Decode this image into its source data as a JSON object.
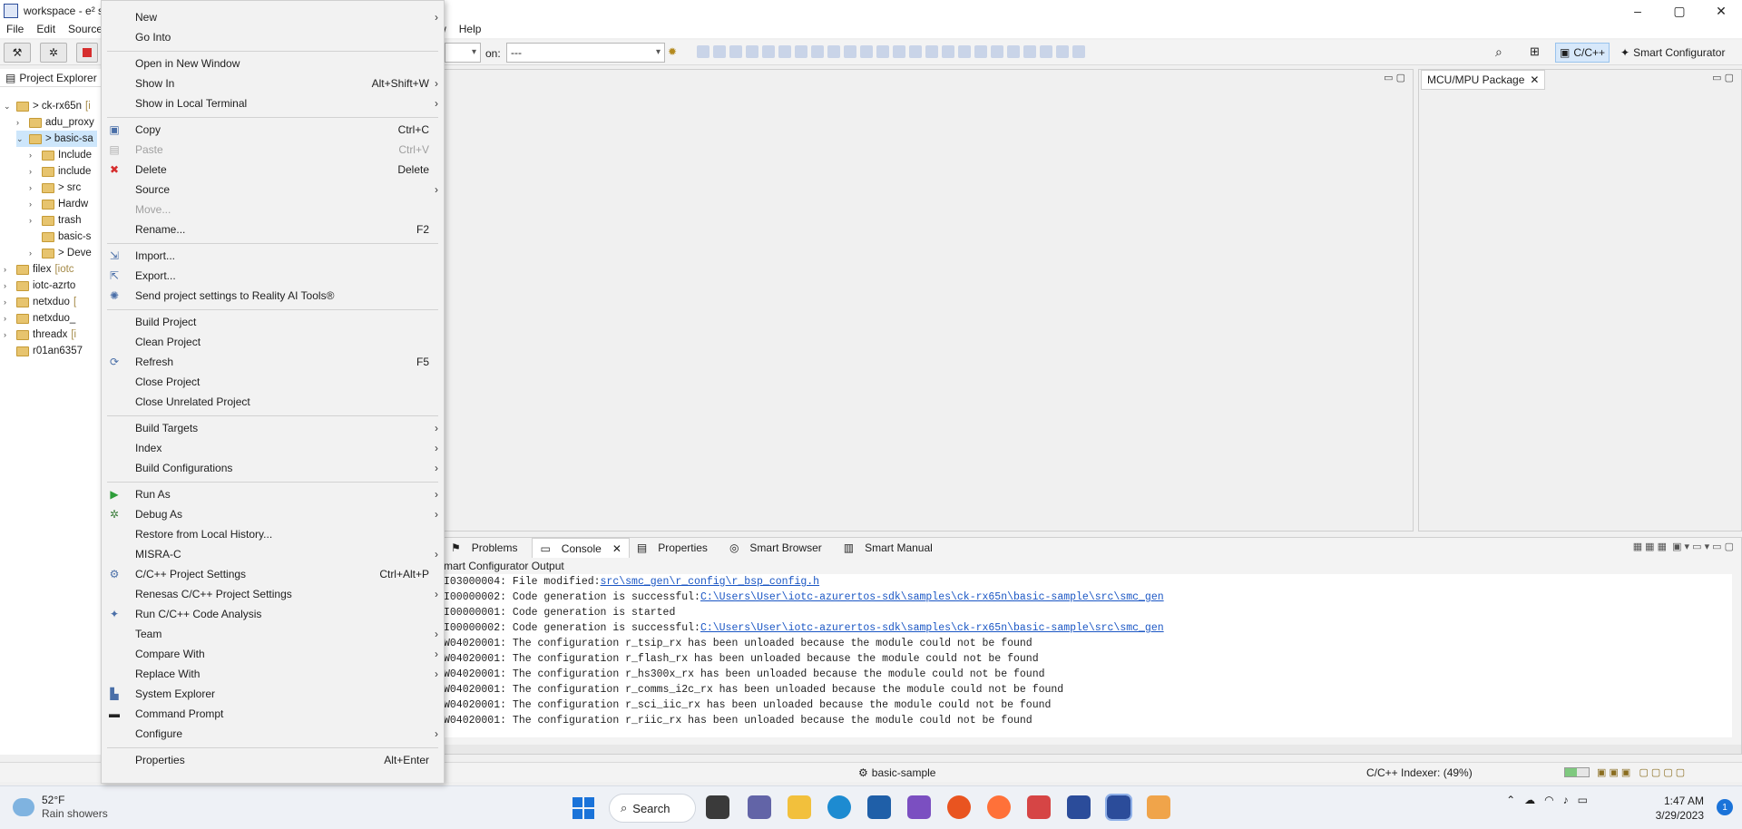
{
  "window": {
    "title": "workspace - e² s",
    "controls": [
      "–",
      "▢",
      "✕"
    ]
  },
  "menubar": [
    "File",
    "Edit",
    "Source",
    "ndow",
    "Help"
  ],
  "toolbar": {
    "combo_value": "---",
    "combo_label": "on:",
    "perspective_active": "C/C++",
    "perspective_other": "Smart Configurator"
  },
  "explorer": {
    "tab_label": "Project Explorer",
    "items": [
      {
        "label": "> ck-rx65n",
        "deco": "[i",
        "depth": 0
      },
      {
        "label": "adu_proxy",
        "deco": "",
        "depth": 1
      },
      {
        "label": "> basic-sa",
        "deco": "",
        "depth": 1
      },
      {
        "label": "Include",
        "deco": "",
        "depth": 2
      },
      {
        "label": "include",
        "deco": "",
        "depth": 2
      },
      {
        "label": "> src",
        "deco": "",
        "depth": 2
      },
      {
        "label": "Hardw",
        "deco": "",
        "depth": 2
      },
      {
        "label": "trash",
        "deco": "",
        "depth": 2
      },
      {
        "label": "basic-s",
        "deco": "",
        "depth": 2
      },
      {
        "label": "> Deve",
        "deco": "",
        "depth": 2
      },
      {
        "label": "filex",
        "deco": "[iotc",
        "depth": 0
      },
      {
        "label": "iotc-azrto",
        "deco": "",
        "depth": 0
      },
      {
        "label": "netxduo",
        "deco": "[",
        "depth": 0
      },
      {
        "label": "netxduo_",
        "deco": "",
        "depth": 0
      },
      {
        "label": "threadx",
        "deco": "[i",
        "depth": 0
      },
      {
        "label": "r01an6357",
        "deco": "",
        "depth": 0
      }
    ]
  },
  "context_menu": {
    "items": [
      {
        "label": "New",
        "shortcut": "",
        "submenu": true,
        "icon": "",
        "disabled": false
      },
      {
        "label": "Go Into",
        "shortcut": "",
        "submenu": false,
        "icon": "",
        "disabled": false
      },
      {
        "sep": true
      },
      {
        "label": "Open in New Window",
        "shortcut": "",
        "submenu": false,
        "icon": "",
        "disabled": false
      },
      {
        "label": "Show In",
        "shortcut": "Alt+Shift+W",
        "submenu": true,
        "icon": "",
        "disabled": false
      },
      {
        "label": "Show in Local Terminal",
        "shortcut": "",
        "submenu": true,
        "icon": "",
        "disabled": false
      },
      {
        "sep": true
      },
      {
        "label": "Copy",
        "shortcut": "Ctrl+C",
        "submenu": false,
        "icon": "copy-icon",
        "disabled": false
      },
      {
        "label": "Paste",
        "shortcut": "Ctrl+V",
        "submenu": false,
        "icon": "paste-icon",
        "disabled": true
      },
      {
        "label": "Delete",
        "shortcut": "Delete",
        "submenu": false,
        "icon": "delete-icon",
        "disabled": false
      },
      {
        "label": "Source",
        "shortcut": "",
        "submenu": true,
        "icon": "",
        "disabled": false
      },
      {
        "label": "Move...",
        "shortcut": "",
        "submenu": false,
        "icon": "",
        "disabled": true
      },
      {
        "label": "Rename...",
        "shortcut": "F2",
        "submenu": false,
        "icon": "",
        "disabled": false
      },
      {
        "sep": true
      },
      {
        "label": "Import...",
        "shortcut": "",
        "submenu": false,
        "icon": "import-icon",
        "disabled": false
      },
      {
        "label": "Export...",
        "shortcut": "",
        "submenu": false,
        "icon": "export-icon",
        "disabled": false
      },
      {
        "label": "Send project settings to Reality AI Tools®",
        "shortcut": "",
        "submenu": false,
        "icon": "reality-ai-icon",
        "disabled": false
      },
      {
        "sep": true
      },
      {
        "label": "Build Project",
        "shortcut": "",
        "submenu": false,
        "icon": "",
        "disabled": false
      },
      {
        "label": "Clean Project",
        "shortcut": "",
        "submenu": false,
        "icon": "",
        "disabled": false
      },
      {
        "label": "Refresh",
        "shortcut": "F5",
        "submenu": false,
        "icon": "refresh-icon",
        "disabled": false
      },
      {
        "label": "Close Project",
        "shortcut": "",
        "submenu": false,
        "icon": "",
        "disabled": false
      },
      {
        "label": "Close Unrelated Project",
        "shortcut": "",
        "submenu": false,
        "icon": "",
        "disabled": false
      },
      {
        "sep": true
      },
      {
        "label": "Build Targets",
        "shortcut": "",
        "submenu": true,
        "icon": "",
        "disabled": false
      },
      {
        "label": "Index",
        "shortcut": "",
        "submenu": true,
        "icon": "",
        "disabled": false
      },
      {
        "label": "Build Configurations",
        "shortcut": "",
        "submenu": true,
        "icon": "",
        "disabled": false
      },
      {
        "sep": true
      },
      {
        "label": "Run As",
        "shortcut": "",
        "submenu": true,
        "icon": "run-icon",
        "disabled": false
      },
      {
        "label": "Debug As",
        "shortcut": "",
        "submenu": true,
        "icon": "debug-icon",
        "disabled": false
      },
      {
        "label": "Restore from Local History...",
        "shortcut": "",
        "submenu": false,
        "icon": "",
        "disabled": false
      },
      {
        "label": "MISRA-C",
        "shortcut": "",
        "submenu": true,
        "icon": "",
        "disabled": false
      },
      {
        "label": "C/C++ Project Settings",
        "shortcut": "Ctrl+Alt+P",
        "submenu": false,
        "icon": "settings-icon",
        "disabled": false
      },
      {
        "label": "Renesas C/C++ Project Settings",
        "shortcut": "",
        "submenu": true,
        "icon": "",
        "disabled": false
      },
      {
        "label": "Run C/C++ Code Analysis",
        "shortcut": "",
        "submenu": false,
        "icon": "analysis-icon",
        "disabled": false
      },
      {
        "label": "Team",
        "shortcut": "",
        "submenu": true,
        "icon": "",
        "disabled": false
      },
      {
        "label": "Compare With",
        "shortcut": "",
        "submenu": true,
        "icon": "",
        "disabled": false
      },
      {
        "label": "Replace With",
        "shortcut": "",
        "submenu": true,
        "icon": "",
        "disabled": false
      },
      {
        "label": "System Explorer",
        "shortcut": "",
        "submenu": false,
        "icon": "system-explorer-icon",
        "disabled": false
      },
      {
        "label": "Command Prompt",
        "shortcut": "",
        "submenu": false,
        "icon": "command-prompt-icon",
        "disabled": false
      },
      {
        "label": "Configure",
        "shortcut": "",
        "submenu": true,
        "icon": "",
        "disabled": false
      },
      {
        "sep": true
      },
      {
        "label": "Properties",
        "shortcut": "Alt+Enter",
        "submenu": false,
        "icon": "",
        "disabled": false
      }
    ]
  },
  "mcu_panel": {
    "tab_label": "MCU/MPU Package"
  },
  "bottom_panel": {
    "tabs": [
      "Problems",
      "Console",
      "Properties",
      "Smart Browser",
      "Smart Manual"
    ],
    "active_tab": "Console",
    "subtitle": "mart Configurator Output",
    "console_lines": [
      {
        "prefix": "I03000004: File modified:",
        "link": "src\\smc_gen\\r_config\\r_bsp_config.h",
        "suffix": ""
      },
      {
        "prefix": "I00000002: Code generation is successful:",
        "link": "C:\\Users\\User\\iotc-azurertos-sdk\\samples\\ck-rx65n\\basic-sample\\src\\smc_gen",
        "suffix": ""
      },
      {
        "prefix": "I00000001: Code generation is started",
        "link": "",
        "suffix": ""
      },
      {
        "prefix": "I00000002: Code generation is successful:",
        "link": "C:\\Users\\User\\iotc-azurertos-sdk\\samples\\ck-rx65n\\basic-sample\\src\\smc_gen",
        "suffix": ""
      },
      {
        "prefix": "W04020001: The configuration r_tsip_rx has been unloaded because the module could not be found",
        "link": "",
        "suffix": ""
      },
      {
        "prefix": "W04020001: The configuration r_flash_rx has been unloaded because the module could not be found",
        "link": "",
        "suffix": ""
      },
      {
        "prefix": "W04020001: The configuration r_hs300x_rx has been unloaded because the module could not be found",
        "link": "",
        "suffix": ""
      },
      {
        "prefix": "W04020001: The configuration r_comms_i2c_rx has been unloaded because the module could not be found",
        "link": "",
        "suffix": ""
      },
      {
        "prefix": "W04020001: The configuration r_sci_iic_rx has been unloaded because the module could not be found",
        "link": "",
        "suffix": ""
      },
      {
        "prefix": "W04020001: The configuration r_riic_rx has been unloaded because the module could not be found",
        "link": "",
        "suffix": ""
      }
    ]
  },
  "statusbar": {
    "project": "basic-sample",
    "indexer": "C/C++ Indexer: (49%)",
    "indexer_progress": 0.49
  },
  "taskbar": {
    "weather_temp": "52°F",
    "weather_desc": "Rain showers",
    "search_label": "Search",
    "time": "1:47 AM",
    "date": "3/29/2023",
    "notification_count": "1"
  }
}
